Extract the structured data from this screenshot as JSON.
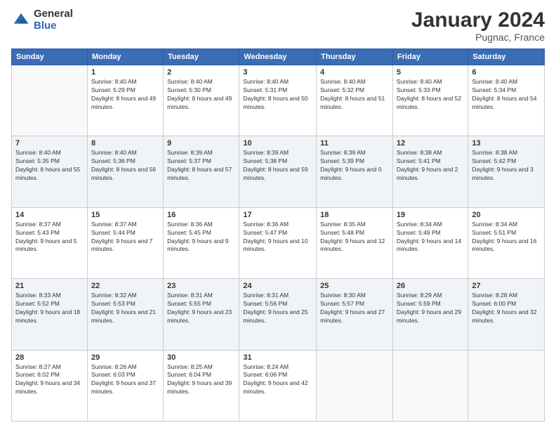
{
  "header": {
    "logo_general": "General",
    "logo_blue": "Blue",
    "month_title": "January 2024",
    "location": "Pugnac, France"
  },
  "weekdays": [
    "Sunday",
    "Monday",
    "Tuesday",
    "Wednesday",
    "Thursday",
    "Friday",
    "Saturday"
  ],
  "weeks": [
    [
      {
        "day": "",
        "sunrise": "",
        "sunset": "",
        "daylight": ""
      },
      {
        "day": "1",
        "sunrise": "Sunrise: 8:40 AM",
        "sunset": "Sunset: 5:29 PM",
        "daylight": "Daylight: 8 hours and 49 minutes."
      },
      {
        "day": "2",
        "sunrise": "Sunrise: 8:40 AM",
        "sunset": "Sunset: 5:30 PM",
        "daylight": "Daylight: 8 hours and 49 minutes."
      },
      {
        "day": "3",
        "sunrise": "Sunrise: 8:40 AM",
        "sunset": "Sunset: 5:31 PM",
        "daylight": "Daylight: 8 hours and 50 minutes."
      },
      {
        "day": "4",
        "sunrise": "Sunrise: 8:40 AM",
        "sunset": "Sunset: 5:32 PM",
        "daylight": "Daylight: 8 hours and 51 minutes."
      },
      {
        "day": "5",
        "sunrise": "Sunrise: 8:40 AM",
        "sunset": "Sunset: 5:33 PM",
        "daylight": "Daylight: 8 hours and 52 minutes."
      },
      {
        "day": "6",
        "sunrise": "Sunrise: 8:40 AM",
        "sunset": "Sunset: 5:34 PM",
        "daylight": "Daylight: 8 hours and 54 minutes."
      }
    ],
    [
      {
        "day": "7",
        "sunrise": "Sunrise: 8:40 AM",
        "sunset": "Sunset: 5:35 PM",
        "daylight": "Daylight: 8 hours and 55 minutes."
      },
      {
        "day": "8",
        "sunrise": "Sunrise: 8:40 AM",
        "sunset": "Sunset: 5:36 PM",
        "daylight": "Daylight: 8 hours and 56 minutes."
      },
      {
        "day": "9",
        "sunrise": "Sunrise: 8:39 AM",
        "sunset": "Sunset: 5:37 PM",
        "daylight": "Daylight: 8 hours and 57 minutes."
      },
      {
        "day": "10",
        "sunrise": "Sunrise: 8:39 AM",
        "sunset": "Sunset: 5:38 PM",
        "daylight": "Daylight: 8 hours and 59 minutes."
      },
      {
        "day": "11",
        "sunrise": "Sunrise: 8:39 AM",
        "sunset": "Sunset: 5:39 PM",
        "daylight": "Daylight: 9 hours and 0 minutes."
      },
      {
        "day": "12",
        "sunrise": "Sunrise: 8:38 AM",
        "sunset": "Sunset: 5:41 PM",
        "daylight": "Daylight: 9 hours and 2 minutes."
      },
      {
        "day": "13",
        "sunrise": "Sunrise: 8:38 AM",
        "sunset": "Sunset: 5:42 PM",
        "daylight": "Daylight: 9 hours and 3 minutes."
      }
    ],
    [
      {
        "day": "14",
        "sunrise": "Sunrise: 8:37 AM",
        "sunset": "Sunset: 5:43 PM",
        "daylight": "Daylight: 9 hours and 5 minutes."
      },
      {
        "day": "15",
        "sunrise": "Sunrise: 8:37 AM",
        "sunset": "Sunset: 5:44 PM",
        "daylight": "Daylight: 9 hours and 7 minutes."
      },
      {
        "day": "16",
        "sunrise": "Sunrise: 8:36 AM",
        "sunset": "Sunset: 5:45 PM",
        "daylight": "Daylight: 9 hours and 9 minutes."
      },
      {
        "day": "17",
        "sunrise": "Sunrise: 8:36 AM",
        "sunset": "Sunset: 5:47 PM",
        "daylight": "Daylight: 9 hours and 10 minutes."
      },
      {
        "day": "18",
        "sunrise": "Sunrise: 8:35 AM",
        "sunset": "Sunset: 5:48 PM",
        "daylight": "Daylight: 9 hours and 12 minutes."
      },
      {
        "day": "19",
        "sunrise": "Sunrise: 8:34 AM",
        "sunset": "Sunset: 5:49 PM",
        "daylight": "Daylight: 9 hours and 14 minutes."
      },
      {
        "day": "20",
        "sunrise": "Sunrise: 8:34 AM",
        "sunset": "Sunset: 5:51 PM",
        "daylight": "Daylight: 9 hours and 16 minutes."
      }
    ],
    [
      {
        "day": "21",
        "sunrise": "Sunrise: 8:33 AM",
        "sunset": "Sunset: 5:52 PM",
        "daylight": "Daylight: 9 hours and 18 minutes."
      },
      {
        "day": "22",
        "sunrise": "Sunrise: 8:32 AM",
        "sunset": "Sunset: 5:53 PM",
        "daylight": "Daylight: 9 hours and 21 minutes."
      },
      {
        "day": "23",
        "sunrise": "Sunrise: 8:31 AM",
        "sunset": "Sunset: 5:55 PM",
        "daylight": "Daylight: 9 hours and 23 minutes."
      },
      {
        "day": "24",
        "sunrise": "Sunrise: 8:31 AM",
        "sunset": "Sunset: 5:56 PM",
        "daylight": "Daylight: 9 hours and 25 minutes."
      },
      {
        "day": "25",
        "sunrise": "Sunrise: 8:30 AM",
        "sunset": "Sunset: 5:57 PM",
        "daylight": "Daylight: 9 hours and 27 minutes."
      },
      {
        "day": "26",
        "sunrise": "Sunrise: 8:29 AM",
        "sunset": "Sunset: 5:59 PM",
        "daylight": "Daylight: 9 hours and 29 minutes."
      },
      {
        "day": "27",
        "sunrise": "Sunrise: 8:28 AM",
        "sunset": "Sunset: 6:00 PM",
        "daylight": "Daylight: 9 hours and 32 minutes."
      }
    ],
    [
      {
        "day": "28",
        "sunrise": "Sunrise: 8:27 AM",
        "sunset": "Sunset: 6:02 PM",
        "daylight": "Daylight: 9 hours and 34 minutes."
      },
      {
        "day": "29",
        "sunrise": "Sunrise: 8:26 AM",
        "sunset": "Sunset: 6:03 PM",
        "daylight": "Daylight: 9 hours and 37 minutes."
      },
      {
        "day": "30",
        "sunrise": "Sunrise: 8:25 AM",
        "sunset": "Sunset: 6:04 PM",
        "daylight": "Daylight: 9 hours and 39 minutes."
      },
      {
        "day": "31",
        "sunrise": "Sunrise: 8:24 AM",
        "sunset": "Sunset: 6:06 PM",
        "daylight": "Daylight: 9 hours and 42 minutes."
      },
      {
        "day": "",
        "sunrise": "",
        "sunset": "",
        "daylight": ""
      },
      {
        "day": "",
        "sunrise": "",
        "sunset": "",
        "daylight": ""
      },
      {
        "day": "",
        "sunrise": "",
        "sunset": "",
        "daylight": ""
      }
    ]
  ]
}
